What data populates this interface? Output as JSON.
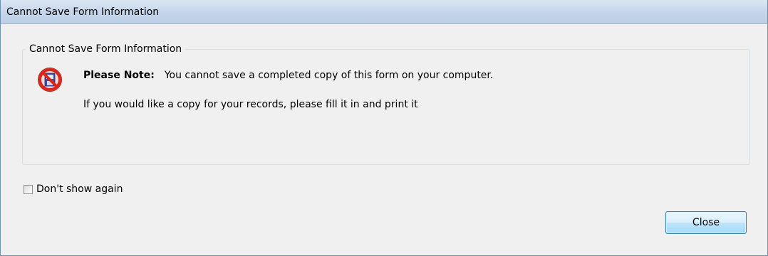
{
  "window": {
    "title": "Cannot Save Form Information"
  },
  "group": {
    "legend": "Cannot Save Form Information",
    "note_label": "Please Note:",
    "note_text": "You cannot save a completed copy of this form on your computer.",
    "copy_text": "If you would like a copy for your records, please fill it in and print it",
    "icon": "no-save-icon"
  },
  "options": {
    "dont_show_label": "Don't show again",
    "dont_show_checked": false
  },
  "buttons": {
    "close_label": "Close"
  },
  "colors": {
    "titlebar": "#c4d5ea",
    "dialog_background": "#f0f0f0",
    "icon_red": "#d7261b",
    "icon_blue": "#3a4fa8"
  }
}
